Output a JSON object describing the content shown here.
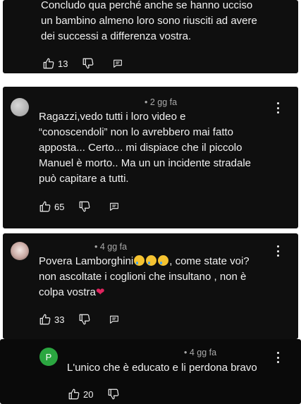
{
  "comments": [
    {
      "lines": [
        "Concludo qua perché anche se hanno ucciso",
        "un bambino almeno loro sono riusciti ad avere",
        "dei successi a differenza vostra."
      ],
      "likes": "13"
    },
    {
      "time": "• 2 gg fa",
      "lines": [
        "Ragazzi,vedo tutti i loro video e",
        "“conoscendoli” non lo avrebbero mai fatto",
        "apposta... Certo... mi dispiace che il piccolo",
        "Manuel è morto.. Ma un un incidente stradale",
        "può capitare a tutti."
      ],
      "likes": "65"
    },
    {
      "time": "• 4 gg fa",
      "line1_start": "Povera Lamborghini",
      "line1_end": ", come state voi?",
      "line2": "non ascoltate i coglioni che insultano  , non è",
      "line3": "colpa vostra",
      "likes": "33"
    },
    {
      "avatar_letter": "P",
      "time": "• 4 gg fa",
      "lines": [
        "L'unico che è educato e li perdona bravo"
      ],
      "likes": "20"
    }
  ],
  "icons": {
    "like": "thumbs-up-icon",
    "dislike": "thumbs-down-icon",
    "reply": "reply-icon",
    "more": "more-vertical-icon",
    "emoji": "crying-face-emoji",
    "heart": "red-heart-emoji"
  },
  "colors": {
    "background": "#0f0f0f",
    "text": "#f1f1f1",
    "meta": "#aaaaaa",
    "reply_avatar": "#2ba640",
    "heart": "#e0245e"
  }
}
